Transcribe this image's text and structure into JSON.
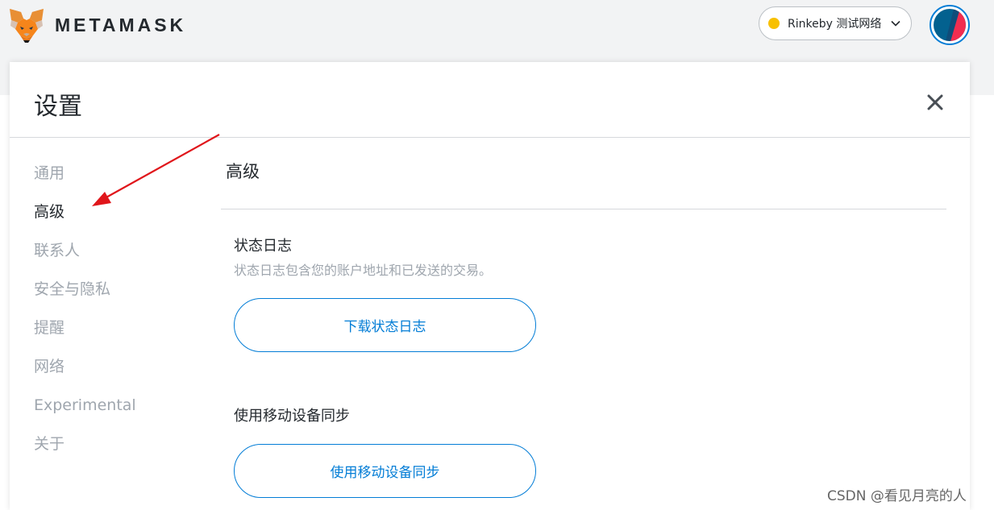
{
  "header": {
    "brand": "METAMASK",
    "network": {
      "label": "Rinkeby 测试网络",
      "dot_color": "#f8c000",
      "icon": "chevron-down-icon"
    },
    "avatar_icon": "account-identicon"
  },
  "settings": {
    "title": "设置",
    "close_icon": "close-icon",
    "nav": [
      {
        "label": "通用",
        "active": false
      },
      {
        "label": "高级",
        "active": true
      },
      {
        "label": "联系人",
        "active": false
      },
      {
        "label": "安全与隐私",
        "active": false
      },
      {
        "label": "提醒",
        "active": false
      },
      {
        "label": "网络",
        "active": false
      },
      {
        "label": "Experimental",
        "active": false
      },
      {
        "label": "关于",
        "active": false
      }
    ]
  },
  "content": {
    "section_title": "高级",
    "state_logs": {
      "title": "状态日志",
      "description": "状态日志包含您的账户地址和已发送的交易。",
      "button": "下载状态日志"
    },
    "mobile_sync": {
      "title": "使用移动设备同步",
      "button": "使用移动设备同步"
    }
  },
  "colors": {
    "accent": "#037dd6",
    "annotation_arrow": "#e0161b"
  },
  "watermark": "CSDN @看见月亮的人"
}
